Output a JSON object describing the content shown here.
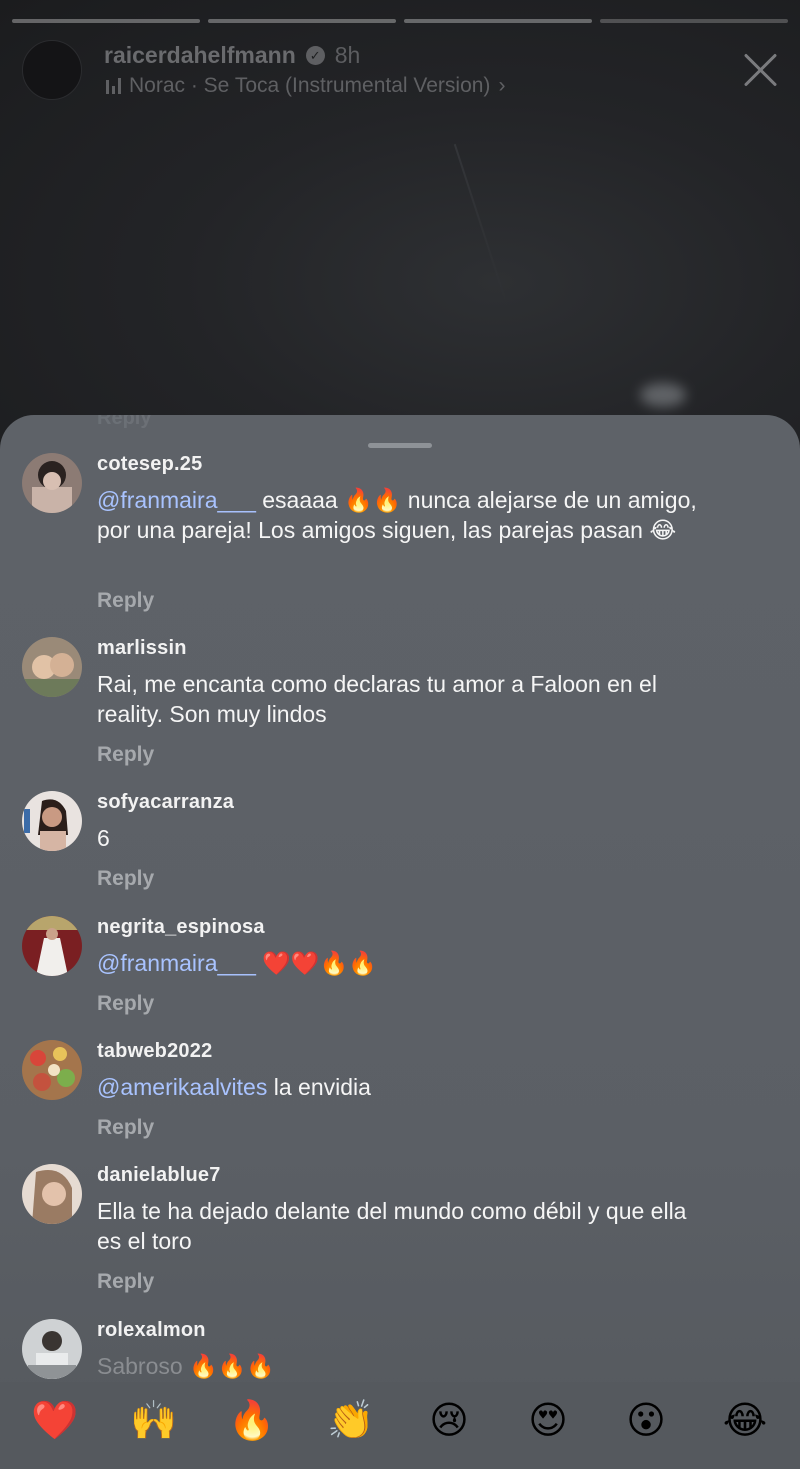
{
  "story": {
    "username": "raicerdahelfmann",
    "time": "8h",
    "music": "Norac · Se Toca (Instrumental Version)",
    "music_chevron": "›",
    "verified_icon": "✓",
    "progress_segments": 4
  },
  "comments": [
    {
      "user": "cotesep.25",
      "mention": "@franmaira___",
      "text": " esaaaa 🔥🔥 nunca alejarse de un amigo, por una pareja! Los amigos siguen, las parejas pasan 😂",
      "reply": "Reply"
    },
    {
      "user": "marlissin",
      "mention": "",
      "text": "Rai, me encanta como declaras tu amor a Faloon en el reality. Son muy lindos",
      "reply": "Reply"
    },
    {
      "user": "sofyacarranza",
      "mention": "",
      "text": "6",
      "reply": "Reply"
    },
    {
      "user": "negrita_espinosa",
      "mention": "@franmaira___",
      "text": " ❤️❤️🔥🔥",
      "reply": "Reply"
    },
    {
      "user": "tabweb2022",
      "mention": "@amerikaalvites",
      "text": " la envidia",
      "reply": "Reply"
    },
    {
      "user": "danielablue7",
      "mention": "",
      "text": "Ella te ha dejado delante del mundo como débil y que ella es el toro",
      "reply": "Reply"
    },
    {
      "user": "rolexalmon",
      "mention": "",
      "text": "Sabroso 🔥🔥🔥",
      "reply": ""
    }
  ],
  "ghost_reply": "Reply",
  "reactions": [
    "❤️",
    "🙌",
    "🔥",
    "👏",
    "😢",
    "😍",
    "😮",
    "😂"
  ],
  "colors": {
    "mention": "#a9c3ff",
    "sheet": "#5e6268"
  }
}
